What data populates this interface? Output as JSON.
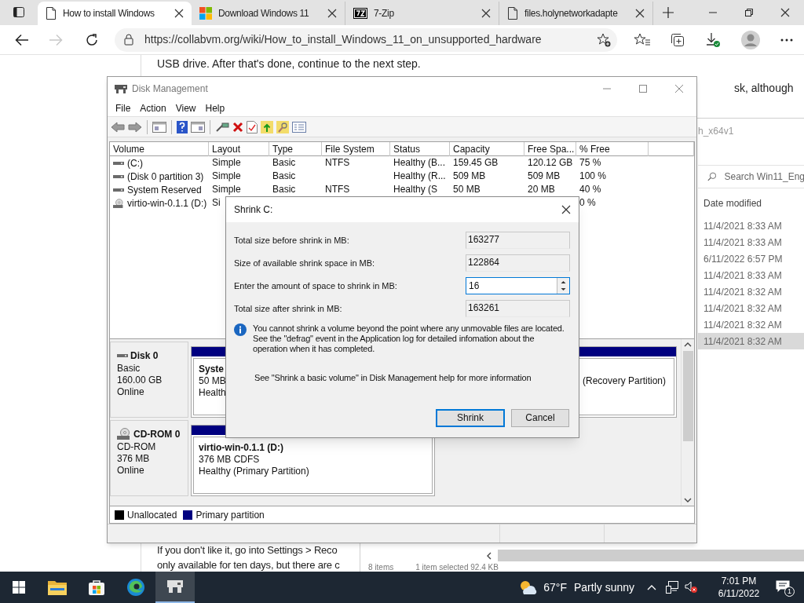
{
  "browser": {
    "tabs": [
      {
        "title": "How to install Windows",
        "selected": true
      },
      {
        "title": "Download Windows 11",
        "selected": false
      },
      {
        "title": "7-Zip",
        "selected": false
      },
      {
        "title": "files.holynetworkadapte",
        "selected": false
      }
    ],
    "forward_disabled": true,
    "url": "https://collabvm.org/wiki/How_to_install_Windows_11_on_unsupported_hardware"
  },
  "article": {
    "top_line": "USB drive. After that's done, continue to the next step.",
    "note_tail": "sk, although",
    "bottom_lines": [
      "If you don't like it, go into Settings > Reco",
      "only available for ten days, but there are c"
    ]
  },
  "explorer": {
    "path_tail": "h_x64v1",
    "search_placeholder": "Search Win11_Eng",
    "column": "Date modified",
    "rows": [
      {
        "date": "11/4/2021 8:33 AM",
        "selected": false
      },
      {
        "date": "11/4/2021 8:33 AM",
        "selected": false
      },
      {
        "date": "6/11/2022 6:57 PM",
        "selected": false
      },
      {
        "date": "11/4/2021 8:33 AM",
        "selected": false
      },
      {
        "date": "11/4/2021 8:32 AM",
        "selected": false
      },
      {
        "date": "11/4/2021 8:32 AM",
        "selected": false
      },
      {
        "date": "11/4/2021 8:32 AM",
        "selected": false
      },
      {
        "date": "11/4/2021 8:32 AM",
        "selected": true
      }
    ],
    "status": [
      "8 items",
      "1 item selected  92.4 KB"
    ]
  },
  "disk_management": {
    "title": "Disk Management",
    "menu": [
      "File",
      "Action",
      "View",
      "Help"
    ],
    "columns": [
      "Volume",
      "Layout",
      "Type",
      "File System",
      "Status",
      "Capacity",
      "Free Spa...",
      "% Free"
    ],
    "volumes": [
      {
        "kind": "disk",
        "volume": "(C:)",
        "layout": "Simple",
        "type": "Basic",
        "file_system": "NTFS",
        "status": "Healthy (B...",
        "capacity": "159.45 GB",
        "free_space": "120.12 GB",
        "percent_free": "75 %"
      },
      {
        "kind": "disk",
        "volume": "(Disk 0 partition 3)",
        "layout": "Simple",
        "type": "Basic",
        "status": "Healthy (R...",
        "capacity": "509 MB",
        "free_space": "509 MB",
        "percent_free": "100 %"
      },
      {
        "kind": "disk",
        "volume": "System Reserved",
        "layout": "Simple",
        "type": "Basic",
        "file_system": "NTFS",
        "status": "Healthy (S",
        "capacity": "50 MB",
        "free_space": "20 MB",
        "percent_free": "40 %"
      },
      {
        "kind": "cd",
        "volume": "virtio-win-0.1.1 (D:)",
        "layout": "Si",
        "percent_free": "0 %"
      }
    ],
    "disks": [
      {
        "kind": "disk",
        "name": "Disk 0",
        "details": [
          "Basic",
          "160.00 GB",
          "Online"
        ],
        "partitions": [
          {
            "name": "Syste",
            "size": "50 MB",
            "status": "Health"
          },
          {
            "status": "(Recovery Partition)"
          }
        ]
      },
      {
        "kind": "cd",
        "name": "CD-ROM 0",
        "details": [
          "CD-ROM",
          "376 MB",
          "Online"
        ],
        "partitions": [
          {
            "name": "virtio-win-0.1.1  (D:)",
            "size": "376 MB CDFS",
            "status": "Healthy (Primary Partition)"
          }
        ]
      }
    ],
    "legend": [
      {
        "label": "Unallocated",
        "color": "#000000"
      },
      {
        "label": "Primary partition",
        "color": "#000080"
      }
    ]
  },
  "dialog": {
    "title": "Shrink C:",
    "fields": [
      {
        "label": "Total size before shrink in MB:",
        "value": "163277",
        "kind": "readonly"
      },
      {
        "label": "Size of available shrink space in MB:",
        "value": "122864",
        "kind": "readonly"
      },
      {
        "label": "Enter the amount of space to shrink in MB:",
        "value": "16",
        "kind": "spin"
      },
      {
        "label": "Total size after shrink in MB:",
        "value": "163261",
        "kind": "readonly"
      }
    ],
    "info": "You cannot shrink a volume beyond the point where any unmovable files are located. See the \"defrag\" event in the Application log for detailed infomation about the operation when it has completed.",
    "help": "See \"Shrink a basic volume\" in Disk Management help for more information",
    "buttons": [
      {
        "label": "Shrink",
        "default": true
      },
      {
        "label": "Cancel",
        "default": false
      }
    ]
  },
  "taskbar": {
    "apps": [
      {
        "active": false
      },
      {
        "active": false
      },
      {
        "active": false
      },
      {
        "active": true
      }
    ],
    "weather": {
      "temp": "67°F",
      "text": "Partly sunny"
    },
    "time": "7:01 PM",
    "date": "6/11/2022",
    "notifications": "1"
  }
}
